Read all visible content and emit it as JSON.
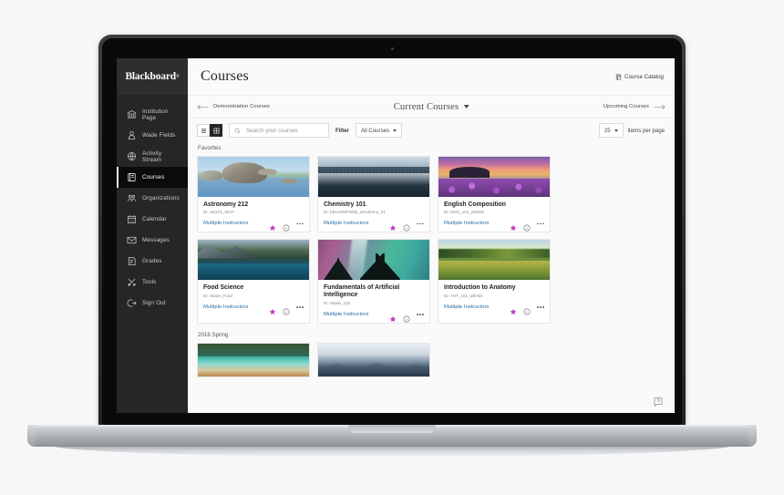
{
  "brand": {
    "name": "Blackboard",
    "trademark": "®"
  },
  "sidebar": {
    "items": [
      {
        "label": "Institution Page",
        "icon": "institution-icon",
        "active": false
      },
      {
        "label": "Wade Fields",
        "icon": "user-icon",
        "active": false
      },
      {
        "label": "Activity Stream",
        "icon": "globe-icon",
        "active": false
      },
      {
        "label": "Courses",
        "icon": "courses-icon",
        "active": true
      },
      {
        "label": "Organizations",
        "icon": "organizations-icon",
        "active": false
      },
      {
        "label": "Calendar",
        "icon": "calendar-icon",
        "active": false
      },
      {
        "label": "Messages",
        "icon": "envelope-icon",
        "active": false
      },
      {
        "label": "Grades",
        "icon": "grades-icon",
        "active": false
      },
      {
        "label": "Tools",
        "icon": "tools-icon",
        "active": false
      },
      {
        "label": "Sign Out",
        "icon": "sign-out-icon",
        "active": false
      }
    ]
  },
  "header": {
    "title": "Courses",
    "catalog_link": "Course Catalog",
    "catalog_icon": "catalog-icon"
  },
  "term_bar": {
    "prev_label": "Demonstration Courses",
    "current_label": "Current Courses",
    "next_label": "Upcoming Courses",
    "prev_icon": "arrow-left-icon",
    "next_icon": "arrow-right-icon",
    "caret_icon": "chevron-down-icon"
  },
  "toolbar": {
    "list_view_icon": "list-view-icon",
    "grid_view_icon": "grid-view-icon",
    "selected_view": "grid",
    "search_placeholder": "Search your courses",
    "search_value": "",
    "search_icon": "search-icon",
    "filter_label": "Filter",
    "filter_value": "All Courses",
    "items_per_page_value": "25",
    "items_per_page_label": "items per page"
  },
  "groups": [
    {
      "title": "Favorites",
      "rows": [
        [
          {
            "title": "Astronomy 212",
            "id": "ID: ast101_WCF",
            "instructors": "Multiple Instructors",
            "favorite": true,
            "art": "art-astro",
            "star_color": "#c23ec2"
          },
          {
            "title": "Chemistry 101",
            "id": "ID: bbw19WFields_ultrademo_01",
            "instructors": "Multiple Instructors",
            "favorite": true,
            "art": "art-chem",
            "star_color": "#c23ec2"
          },
          {
            "title": "English Composition",
            "id": "ID: ENG_101_wfields",
            "instructors": "Multiple Instructors",
            "favorite": true,
            "art": "art-eng",
            "star_color": "#c23ec2"
          }
        ],
        [
          {
            "title": "Food Science",
            "id": "ID: Wade_Food",
            "instructors": "Multiple Instructors",
            "favorite": true,
            "art": "art-food",
            "star_color": "#c23ec2"
          },
          {
            "title": "Fundamentals of Artificial Intelligence",
            "id": "ID: Wade_102",
            "instructors": "Multiple Instructors",
            "favorite": true,
            "art": "art-ai",
            "star_color": "#c23ec2"
          },
          {
            "title": "Introduction to Anatomy",
            "id": "ID: AST_101_wfields",
            "instructors": "Multiple Instructors",
            "favorite": true,
            "art": "art-anat",
            "star_color": "#c23ec2"
          }
        ]
      ]
    },
    {
      "title": "2018 Spring",
      "rows": [
        [
          {
            "art": "art-spring1"
          },
          {
            "art": "art-spring2"
          }
        ]
      ]
    }
  ],
  "help": {
    "icon": "help-icon",
    "label": "Help"
  }
}
